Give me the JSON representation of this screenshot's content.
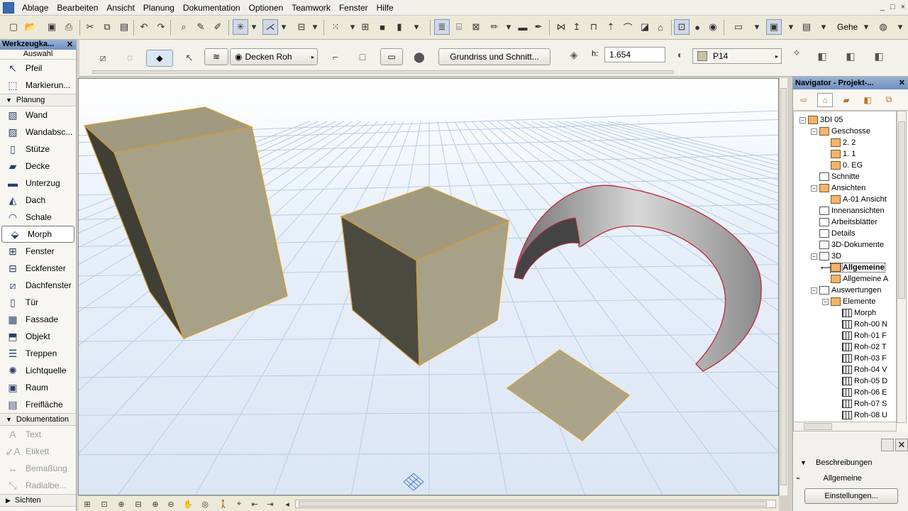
{
  "menubar": {
    "items": [
      "Ablage",
      "Bearbeiten",
      "Ansicht",
      "Planung",
      "Dokumentation",
      "Optionen",
      "Teamwork",
      "Fenster",
      "Hilfe"
    ],
    "window_controls": [
      "_",
      "□",
      "×"
    ]
  },
  "toolbar": {
    "gehe_label": "Gehe"
  },
  "infobox": {
    "layer_label": "Decken Roh",
    "section_button": "Grundriss und Schnitt...",
    "height_label": "h:",
    "height_value": "1.654",
    "pen_value": "P14"
  },
  "toolbox": {
    "title": "Werkzeugka...",
    "selection_label": "Auswahl",
    "top_tools": [
      "Pfeil",
      "Markierun..."
    ],
    "groups": [
      {
        "name": "Planung",
        "tools": [
          "Wand",
          "Wandabsc...",
          "Stütze",
          "Decke",
          "Unterzug",
          "Dach",
          "Schale",
          "Morph",
          "Fenster",
          "Eckfenster",
          "Dachfenster",
          "Tür",
          "Fassade",
          "Objekt",
          "Treppen",
          "Lichtquelle",
          "Raum",
          "Freifläche"
        ]
      },
      {
        "name": "Dokumentation",
        "tools": [
          "Text",
          "Etikett",
          "Bemaßung",
          "Radialbe..."
        ]
      },
      {
        "name": "Sichten",
        "tools": []
      }
    ],
    "active_tool": "Morph"
  },
  "navigator": {
    "title": "Navigator - Projekt-...",
    "tree": [
      {
        "label": "3DI 05",
        "level": 0
      },
      {
        "label": "Geschosse",
        "level": 1
      },
      {
        "label": "2. 2",
        "level": 2
      },
      {
        "label": "1. 1",
        "level": 2
      },
      {
        "label": "0. EG",
        "level": 2
      },
      {
        "label": "Schnitte",
        "level": 1
      },
      {
        "label": "Ansichten",
        "level": 1
      },
      {
        "label": "A-01 Ansicht",
        "level": 2
      },
      {
        "label": "Innenansichten",
        "level": 1
      },
      {
        "label": "Arbeitsblätter",
        "level": 1
      },
      {
        "label": "Details",
        "level": 1
      },
      {
        "label": "3D-Dokumente",
        "level": 1
      },
      {
        "label": "3D",
        "level": 1
      },
      {
        "label": "Allgemeine",
        "level": 2
      },
      {
        "label": "Allgemeine A",
        "level": 2
      },
      {
        "label": "Auswertungen",
        "level": 1
      },
      {
        "label": "Elemente",
        "level": 2
      },
      {
        "label": "Morph",
        "level": 3
      },
      {
        "label": "Roh-00 N",
        "level": 3
      },
      {
        "label": "Roh-01 F",
        "level": 3
      },
      {
        "label": "Roh-02 T",
        "level": 3
      },
      {
        "label": "Roh-03 F",
        "level": 3
      },
      {
        "label": "Roh-04 V",
        "level": 3
      },
      {
        "label": "Roh-05 D",
        "level": 3
      },
      {
        "label": "Roh-06 E",
        "level": 3
      },
      {
        "label": "Roh-07 S",
        "level": 3
      },
      {
        "label": "Roh-08 U",
        "level": 3
      }
    ],
    "selected": "Allgemeine",
    "beschreibungen_label": "Beschreibungen",
    "allgemeine_label": "Allgemeine",
    "einstellungen_button": "Einstellungen..."
  },
  "colors": {
    "morph_fill": "#a39d82",
    "morph_edge": "#d99a2b",
    "arch_edge": "#c0283c",
    "grid_line": "#b7cbe3"
  }
}
